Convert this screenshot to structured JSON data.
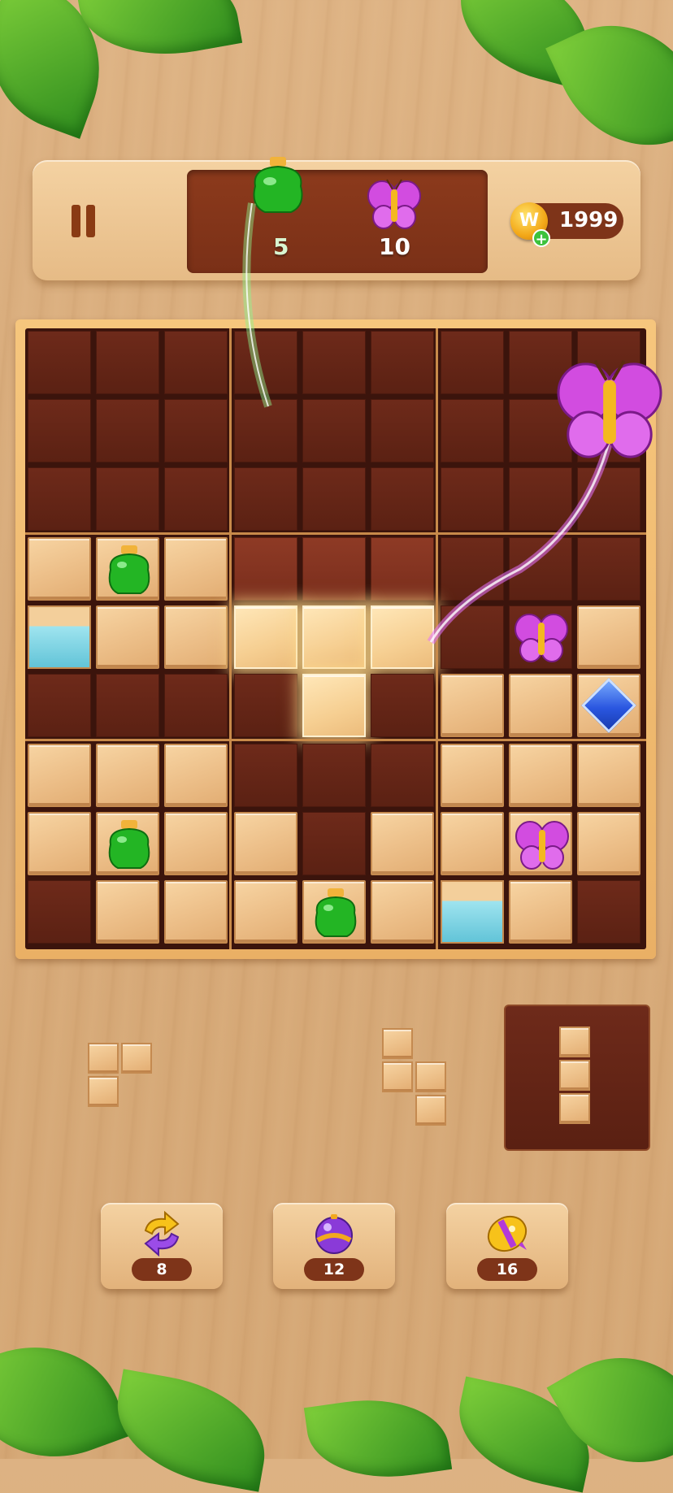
{
  "header": {
    "goals": [
      {
        "icon": "green-potion-icon",
        "remaining": "5"
      },
      {
        "icon": "butterfly-icon",
        "remaining": "10"
      }
    ],
    "coins": "1999",
    "coin_symbol": "W",
    "coin_plus": "+"
  },
  "board": {
    "size": 9,
    "rows": [
      [
        "empty",
        "empty",
        "empty",
        "empty",
        "empty",
        "empty",
        "empty",
        "empty",
        "empty"
      ],
      [
        "empty",
        "empty",
        "empty",
        "empty",
        "empty",
        "empty",
        "empty",
        "empty",
        "butterfly-flying"
      ],
      [
        "empty",
        "empty",
        "empty",
        "empty",
        "empty",
        "empty",
        "empty",
        "empty",
        "empty"
      ],
      [
        "wood",
        "potion",
        "wood",
        "highlight",
        "highlight",
        "highlight",
        "empty",
        "empty",
        "empty"
      ],
      [
        "ice-wood",
        "wood",
        "wood",
        "glow",
        "glow",
        "glow",
        "empty",
        "butterfly",
        "wood"
      ],
      [
        "empty",
        "empty",
        "empty",
        "empty",
        "glow",
        "empty",
        "wood",
        "wood",
        "gem"
      ],
      [
        "wood",
        "wood",
        "wood",
        "empty",
        "empty",
        "empty",
        "wood",
        "wood",
        "wood"
      ],
      [
        "wood",
        "potion",
        "wood",
        "wood",
        "empty",
        "wood",
        "wood",
        "butterfly",
        "wood"
      ],
      [
        "empty",
        "wood",
        "wood",
        "wood",
        "potion",
        "wood",
        "ice-wood",
        "wood",
        "empty"
      ]
    ]
  },
  "pieces": [
    {
      "name": "piece-l-corner",
      "cells": [
        [
          0,
          0
        ],
        [
          0,
          1
        ],
        [
          1,
          0
        ]
      ]
    },
    {
      "name": "piece-s-shape",
      "cells": [
        [
          0,
          0
        ],
        [
          1,
          0
        ],
        [
          1,
          1
        ],
        [
          2,
          1
        ]
      ]
    },
    {
      "name": "piece-vertical-3",
      "cells": [
        [
          0,
          0
        ],
        [
          1,
          0
        ],
        [
          2,
          0
        ]
      ],
      "selected": true
    }
  ],
  "boosters": [
    {
      "name": "refresh-booster",
      "icon": "refresh-arrows-icon",
      "count": "8"
    },
    {
      "name": "bomb-booster",
      "icon": "purple-bomb-icon",
      "count": "12"
    },
    {
      "name": "rocket-booster",
      "icon": "rocket-icon",
      "count": "16"
    }
  ],
  "colors": {
    "accent_brown": "#7e3419",
    "wood": "#edc08a",
    "board_empty": "#6e2a1a"
  }
}
